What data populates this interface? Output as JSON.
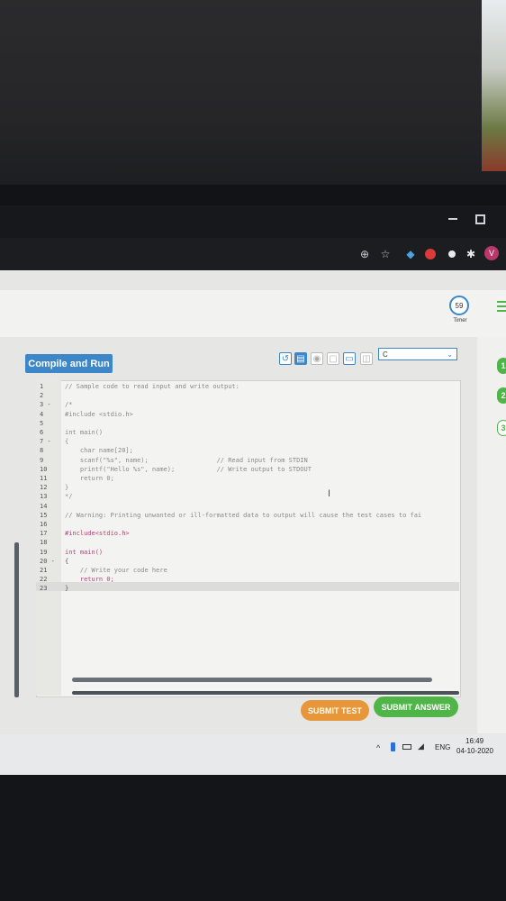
{
  "timer": {
    "value": "59",
    "label": "Timer"
  },
  "editor": {
    "compile_label": "Compile and Run",
    "language": "C",
    "lines": [
      {
        "n": "1",
        "code": "// Sample code to read input and write output:",
        "cls": "c-comment"
      },
      {
        "n": "2",
        "code": "",
        "cls": ""
      },
      {
        "n": "3 -",
        "code": "/*",
        "cls": "c-comment"
      },
      {
        "n": "4",
        "code": "#include <stdio.h>",
        "cls": "c-comment"
      },
      {
        "n": "5",
        "code": "",
        "cls": ""
      },
      {
        "n": "6",
        "code": "int main()",
        "cls": "c-comment"
      },
      {
        "n": "7 -",
        "code": "{",
        "cls": "c-comment"
      },
      {
        "n": "8",
        "code": "    char name[20];",
        "cls": "c-comment"
      },
      {
        "n": "9",
        "code": "    scanf(\"%s\", name);                  // Read input from STDIN",
        "cls": "c-comment"
      },
      {
        "n": "10",
        "code": "    printf(\"Hello %s\", name);           // Write output to STDOUT",
        "cls": "c-comment"
      },
      {
        "n": "11",
        "code": "    return 0;",
        "cls": "c-comment"
      },
      {
        "n": "12",
        "code": "}",
        "cls": "c-comment"
      },
      {
        "n": "13",
        "code": "*/",
        "cls": "c-comment"
      },
      {
        "n": "14",
        "code": "",
        "cls": ""
      },
      {
        "n": "15",
        "code": "// Warning: Printing unwanted or ill-formatted data to output will cause the test cases to fai",
        "cls": "c-comment"
      },
      {
        "n": "16",
        "code": "",
        "cls": ""
      },
      {
        "n": "17",
        "code": "#include<stdio.h>",
        "cls": "c-kw"
      },
      {
        "n": "18",
        "code": "",
        "cls": ""
      },
      {
        "n": "19",
        "code": "int main()",
        "cls": "c-kw"
      },
      {
        "n": "20 -",
        "code": "{",
        "cls": ""
      },
      {
        "n": "21",
        "code": "    // Write your code here",
        "cls": "c-comment"
      },
      {
        "n": "22",
        "code": "    return 0;",
        "cls": "c-kw"
      },
      {
        "n": "23",
        "code": "}",
        "cls": ""
      }
    ]
  },
  "buttons": {
    "submit_test": "SUBMIT TEST",
    "submit_answer": "SUBMIT ANSWER"
  },
  "side_questions": [
    "1",
    "2",
    "3"
  ],
  "taskbar": {
    "lang": "ENG",
    "time": "16:49",
    "date": "04-10-2020"
  },
  "browser": {
    "avatar_letter": "V"
  },
  "colors": {
    "accent": "#3d87c9",
    "submit_test": "#e8963a",
    "submit_answer": "#4fb548",
    "question_green": "#4fb548"
  }
}
